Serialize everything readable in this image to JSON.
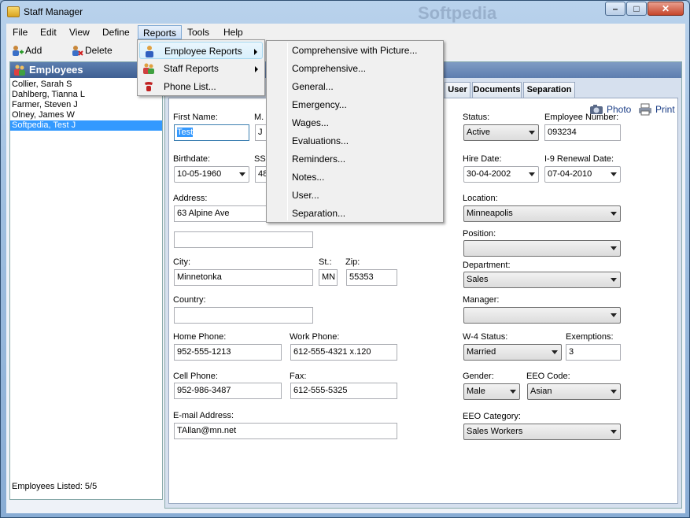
{
  "window": {
    "title": "Staff Manager",
    "watermark": "Softpedia",
    "minimize_glyph": "–",
    "maximize_glyph": "□",
    "close_glyph": "✕"
  },
  "menubar": {
    "items": [
      "File",
      "Edit",
      "View",
      "Define",
      "Reports",
      "Tools",
      "Help"
    ]
  },
  "toolbar": {
    "add_label": "Add",
    "delete_label": "Delete"
  },
  "reports_menu": {
    "items": [
      {
        "label": "Employee Reports",
        "icon": "person-icon",
        "has_submenu": true
      },
      {
        "label": "Staff Reports",
        "icon": "people-icon",
        "has_submenu": true
      },
      {
        "label": "Phone List...",
        "icon": "phone-icon",
        "has_submenu": false
      }
    ]
  },
  "employee_reports_submenu": {
    "items": [
      "Comprehensive with Picture...",
      "Comprehensive...",
      "General...",
      "Emergency...",
      "Wages...",
      "Evaluations...",
      "Reminders...",
      "Notes...",
      "User...",
      "Separation..."
    ]
  },
  "employees_panel": {
    "title": "Employees",
    "employees": [
      "Collier, Sarah S",
      "Dahlberg, Tianna L",
      "Farmer, Steven J",
      "Olney, James W",
      "Softpedia, Test J"
    ],
    "selected_index": 4,
    "footer": "Employees Listed: 5/5"
  },
  "tabs": [
    "User",
    "Documents",
    "Separation"
  ],
  "actions": {
    "photo_label": "Photo",
    "print_label": "Print"
  },
  "form": {
    "first_name_label": "First Name:",
    "first_name": "Test",
    "mi_label": "M.",
    "mi": "J",
    "birthdate_label": "Birthdate:",
    "birthdate": "10-05-1960",
    "ssn_label": "SS",
    "ssn": "48",
    "address_label": "Address:",
    "address1": "63 Alpine Ave",
    "address2": "",
    "city_label": "City:",
    "city": "Minnetonka",
    "state_label": "St.:",
    "state": "MN",
    "zip_label": "Zip:",
    "zip": "55353",
    "country_label": "Country:",
    "country": "",
    "home_phone_label": "Home Phone:",
    "home_phone": "952-555-1213",
    "work_phone_label": "Work Phone:",
    "work_phone": "612-555-4321 x.120",
    "cell_phone_label": "Cell Phone:",
    "cell_phone": "952-986-3487",
    "fax_label": "Fax:",
    "fax": "612-555-5325",
    "email_label": "E-mail Address:",
    "email": "TAllan@mn.net",
    "status_label": "Status:",
    "status": "Active",
    "emp_number_label": "Employee Number:",
    "emp_number": "093234",
    "hire_date_label": "Hire Date:",
    "hire_date": "30-04-2002",
    "i9_label": "I-9 Renewal Date:",
    "i9_date": "07-04-2010",
    "location_label": "Location:",
    "location": "Minneapolis",
    "position_label": "Position:",
    "position": "",
    "department_label": "Department:",
    "department": "Sales",
    "manager_label": "Manager:",
    "manager": "",
    "w4_label": "W-4 Status:",
    "w4_status": "Married",
    "exemptions_label": "Exemptions:",
    "exemptions": "3",
    "gender_label": "Gender:",
    "gender": "Male",
    "eeo_code_label": "EEO Code:",
    "eeo_code": "Asian",
    "eeo_category_label": "EEO Category:",
    "eeo_category": "Sales Workers"
  }
}
